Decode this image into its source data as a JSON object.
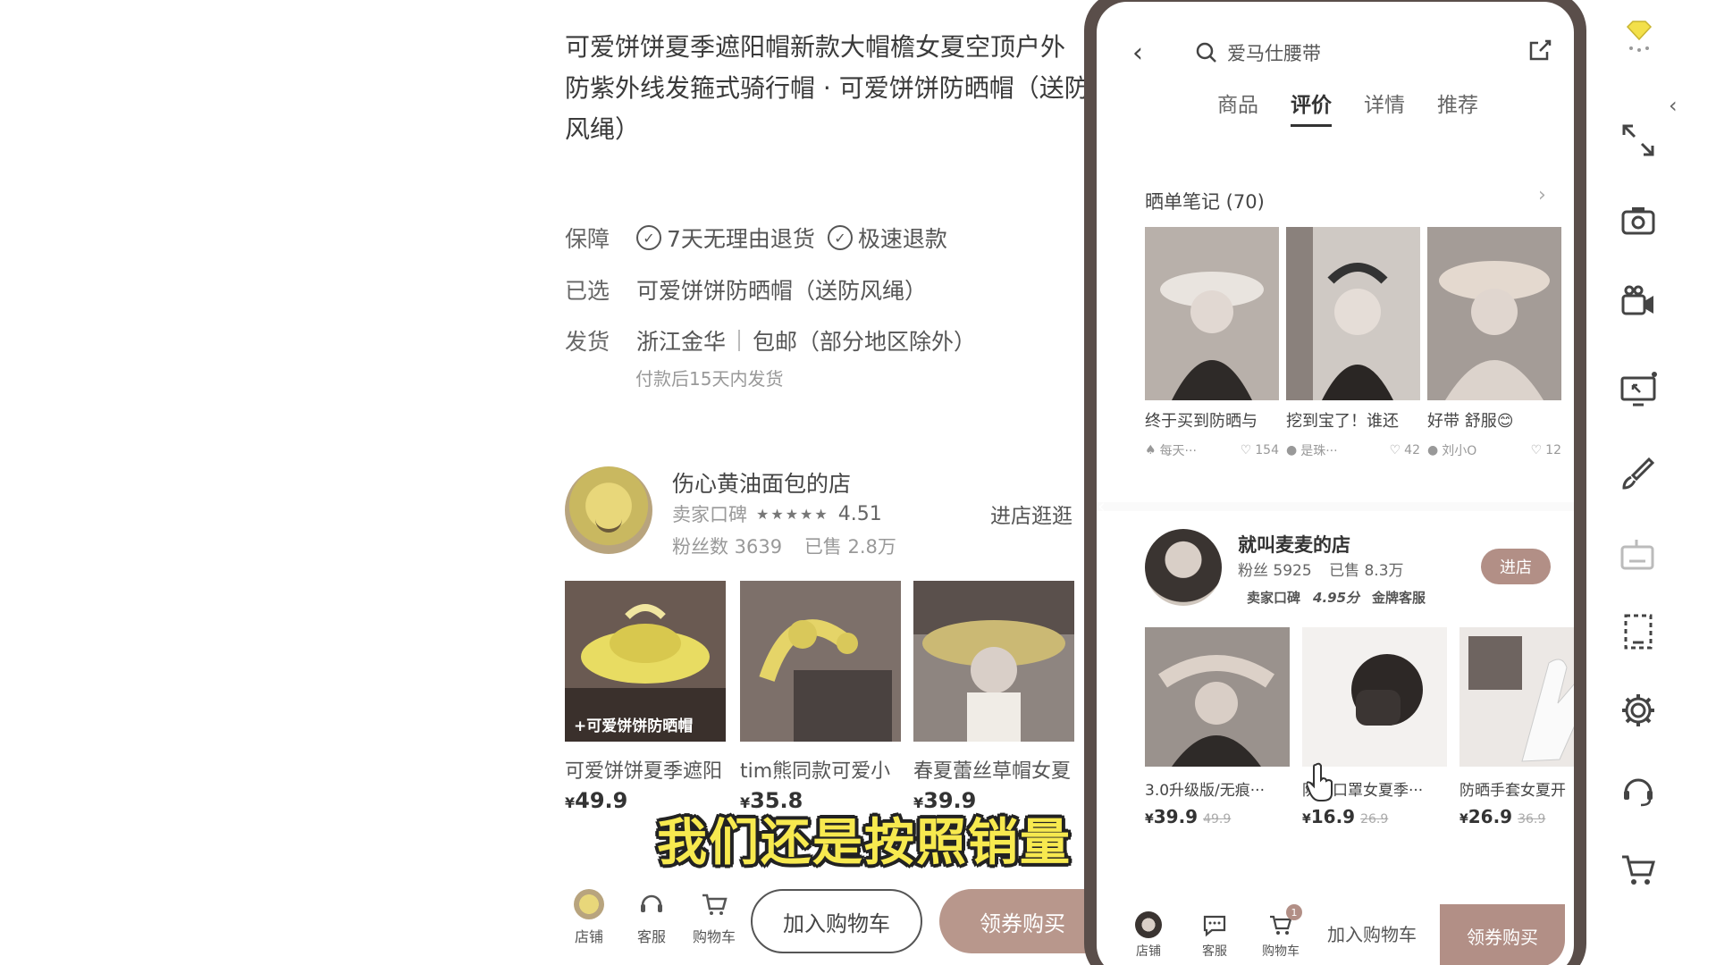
{
  "left": {
    "title_lines": [
      "可爱饼饼夏季遮阳帽新款大帽檐女夏空顶户外",
      "防紫外线发箍式骑行帽 · 可爱饼饼防晒帽（送防",
      "风绳）"
    ],
    "guarantee_label": "保障",
    "guarantee_items": [
      "7天无理由退货",
      "极速退款"
    ],
    "selected_label": "已选",
    "selected_value": "可爱饼饼防晒帽（送防风绳）",
    "ship_label": "发货",
    "ship_origin": "浙江金华",
    "ship_free": "包邮（部分地区除外）",
    "ship_note": "付款后15天内发货",
    "shop": {
      "name": "伤心黄油面包的店",
      "rating_label": "卖家口碑",
      "rating": "4.51",
      "fans": "粉丝数 3639",
      "sold": "已售 2.8万",
      "enter": "进店逛逛"
    },
    "products": [
      {
        "name": "可爱饼饼夏季遮阳",
        "currency": "¥",
        "price": "49.9",
        "img_text": "+可爱饼饼防晒帽"
      },
      {
        "name": "tim熊同款可爱小",
        "currency": "¥",
        "price": "35.8"
      },
      {
        "name": "春夏蕾丝草帽女夏",
        "currency": "¥",
        "price": "39.9"
      }
    ],
    "bottom": {
      "shop": "店铺",
      "service": "客服",
      "cart": "购物车",
      "add_cart": "加入购物车",
      "buy": "领券购买"
    }
  },
  "phone": {
    "search": "爱马仕腰带",
    "tabs": [
      "商品",
      "评价",
      "详情",
      "推荐"
    ],
    "active_tab": 1,
    "review_title": "晒单笔记 (70)",
    "reviews": [
      {
        "caption": "终于买到防晒与",
        "user": "每天···",
        "likes": "154"
      },
      {
        "caption": "挖到宝了！谁还",
        "user": "是珠···",
        "likes": "42"
      },
      {
        "caption": "好带 舒服😊",
        "user": "刘小O",
        "likes": "12"
      }
    ],
    "shop2": {
      "name": "就叫麦麦的店",
      "fans": "粉丝 5925",
      "sold": "已售 8.3万",
      "rating_label": "卖家口碑",
      "rating": "4.95分",
      "badge": "金牌客服",
      "enter": "进店"
    },
    "products": [
      {
        "name": "3.0升级版/无痕···",
        "price": "39.9",
        "old": "49.9"
      },
      {
        "name": "防晒口罩女夏季···",
        "price": "16.9",
        "old": "26.9"
      },
      {
        "name": "防晒手套女夏开",
        "price": "26.9",
        "old": "36.9"
      }
    ],
    "bottom": {
      "shop": "店铺",
      "service": "客服",
      "cart": "购物车",
      "cart_badge": "1",
      "add_cart": "加入购物车",
      "buy": "领券购买"
    }
  },
  "subtitle": "我们还是按照销量",
  "colors": {
    "accent": "#b28f86",
    "subtitle": "#f7e94f"
  }
}
